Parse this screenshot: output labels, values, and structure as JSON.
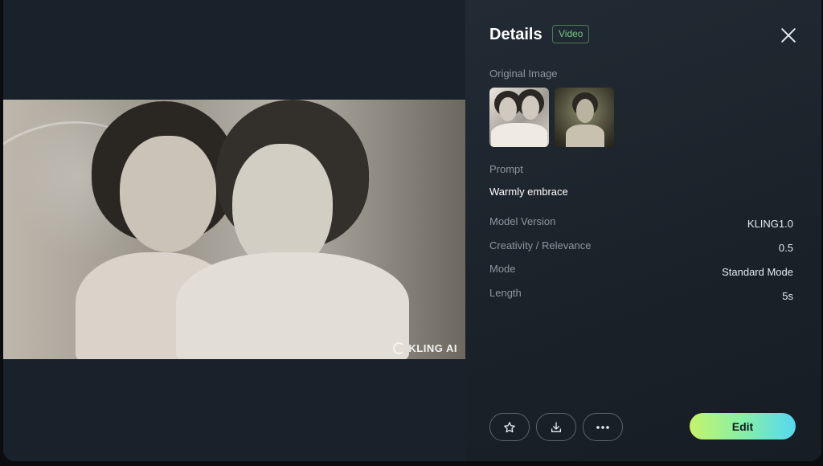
{
  "preview": {
    "watermark": "KLING AI"
  },
  "details": {
    "title": "Details",
    "badge": "Video",
    "original_image_label": "Original Image",
    "prompt_label": "Prompt",
    "prompt_value": "Warmly embrace",
    "rows": [
      {
        "label": "Model Version",
        "value": "KLING1.0"
      },
      {
        "label": "Creativity / Relevance",
        "value": "0.5"
      },
      {
        "label": "Mode",
        "value": "Standard Mode"
      },
      {
        "label": "Length",
        "value": "5s"
      }
    ]
  },
  "actions": {
    "edit_label": "Edit"
  },
  "icons": [
    "close-icon",
    "star-icon",
    "download-icon",
    "more-icon",
    "kling-logo-icon"
  ],
  "colors": {
    "panel_bg": "#1c242d",
    "badge_green": "#79c786",
    "edit_gradient_start": "#c6f36b",
    "edit_gradient_end": "#56d8f1"
  }
}
